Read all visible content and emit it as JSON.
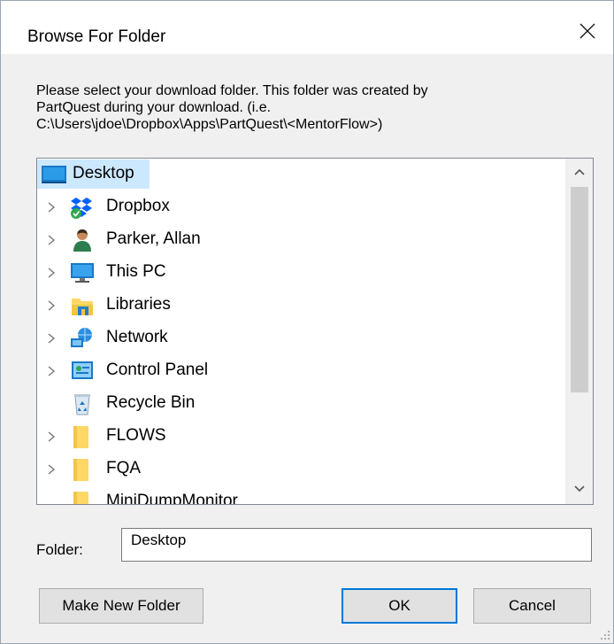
{
  "dialog": {
    "title": "Browse For Folder",
    "description_lines": [
      "Please select your download folder.  This folder was created by",
      "PartQuest during your download. (i.e.",
      "C:\\Users\\jdoe\\Dropbox\\Apps\\PartQuest\\<MentorFlow>)"
    ]
  },
  "tree": {
    "items": [
      {
        "label": "Desktop",
        "icon": "desktop-icon",
        "selected": true,
        "expander": false
      },
      {
        "label": "Dropbox",
        "icon": "dropbox-icon",
        "expander": true
      },
      {
        "label": "Parker, Allan",
        "icon": "user-icon",
        "expander": true
      },
      {
        "label": "This PC",
        "icon": "computer-icon",
        "expander": true
      },
      {
        "label": "Libraries",
        "icon": "libraries-icon",
        "expander": true
      },
      {
        "label": "Network",
        "icon": "network-icon",
        "expander": true
      },
      {
        "label": "Control Panel",
        "icon": "control-panel-icon",
        "expander": true
      },
      {
        "label": "Recycle Bin",
        "icon": "recycle-bin-icon",
        "expander": false
      },
      {
        "label": "FLOWS",
        "icon": "folder-icon",
        "expander": true
      },
      {
        "label": "FQA",
        "icon": "folder-icon",
        "expander": true
      },
      {
        "label": "MiniDumpMonitor",
        "icon": "folder-icon",
        "expander": false
      }
    ]
  },
  "folder": {
    "label": "Folder:",
    "value": "Desktop"
  },
  "buttons": {
    "make_new_folder": "Make New Folder",
    "ok": "OK",
    "cancel": "Cancel"
  },
  "colors": {
    "selection": "#cce8ff",
    "accent": "#0078d7",
    "folder": "#ffd767"
  }
}
